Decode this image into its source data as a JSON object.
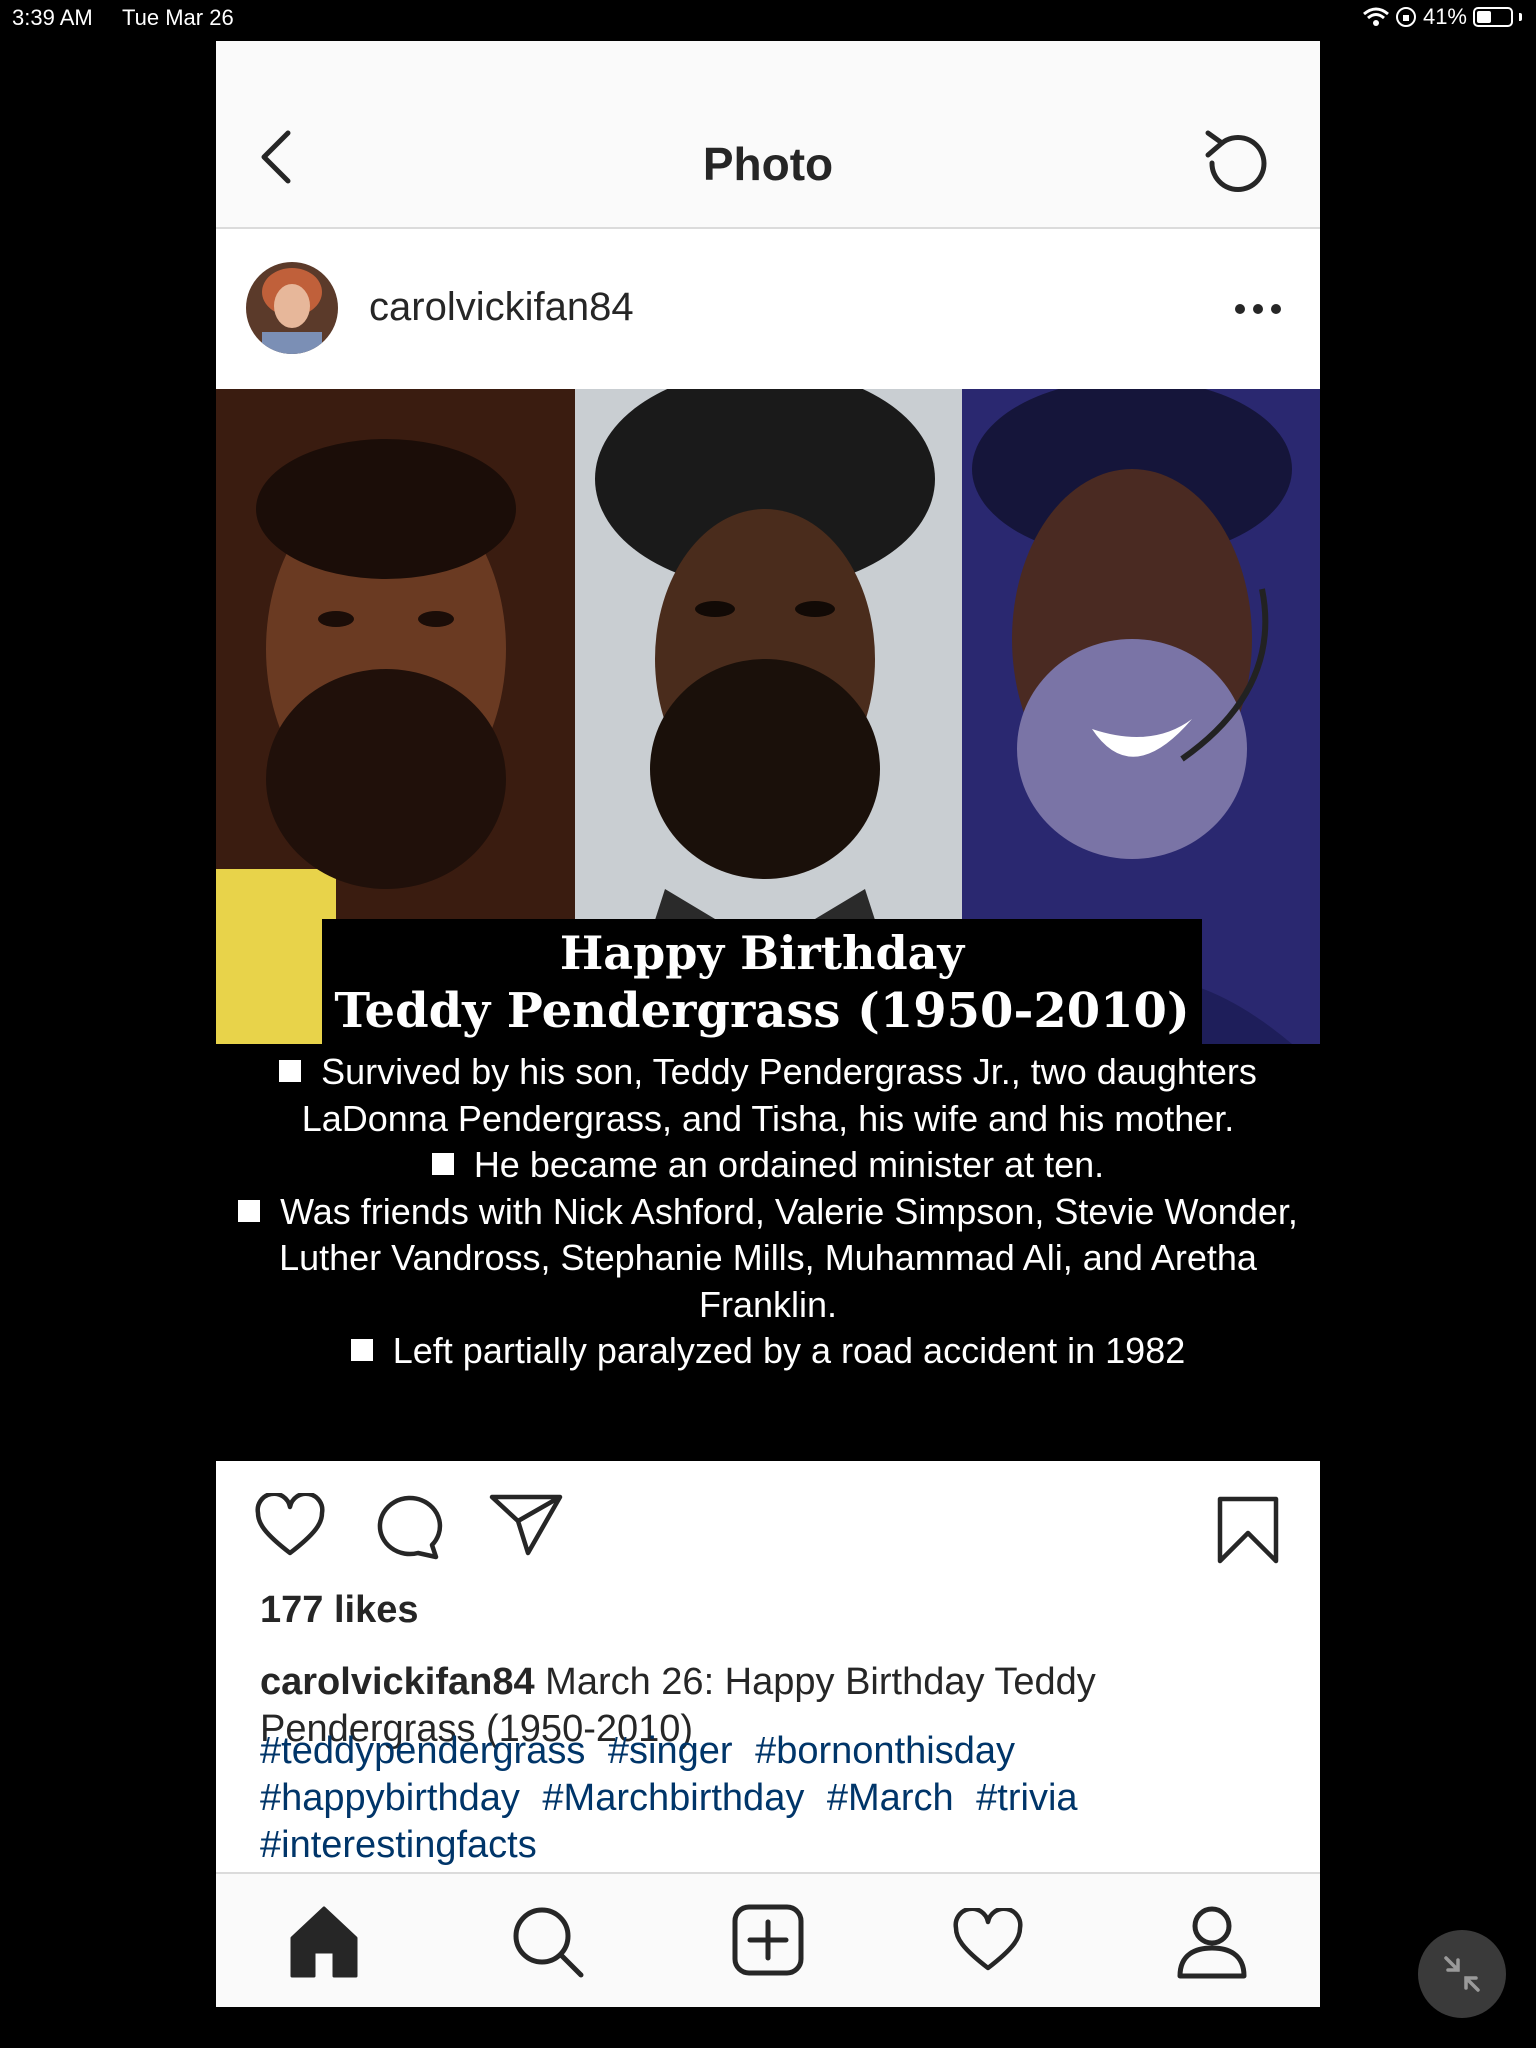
{
  "status_bar": {
    "time": "3:39 AM",
    "date": "Tue Mar 26",
    "battery": "41%"
  },
  "nav": {
    "title": "Photo",
    "back_icon": "chevron-left-icon",
    "refresh_icon": "refresh-icon"
  },
  "post": {
    "username": "carolvickifan84",
    "image": {
      "banner_line1": "Happy Birthday",
      "banner_line2": "Teddy Pendergrass (1950-2010)",
      "facts": [
        "Survived by his son, Teddy Pendergrass Jr., two daughters LaDonna Pendergrass, and Tisha, his wife and his mother.",
        "He became an ordained minister at ten.",
        "Was friends with Nick Ashford, Valerie Simpson, Stevie Wonder, Luther Vandross, Stephanie Mills, Muhammad Ali, and Aretha Franklin.",
        "Left partially paralyzed by a road accident in 1982"
      ]
    },
    "likes": "177 likes",
    "caption_user": "carolvickifan84",
    "caption_text": " March 26: Happy Birthday Teddy Pendergrass (1950-2010)",
    "hashtags": [
      "#teddypendergrass",
      "#singer",
      "#bornonthisday",
      "#happybirthday",
      "#Marchbirthday",
      "#March",
      "#trivia",
      "#interestingfacts"
    ]
  },
  "tab_bar": {
    "items": [
      "home-icon",
      "search-icon",
      "add-post-icon",
      "activity-heart-icon",
      "profile-icon"
    ]
  },
  "colors": {
    "hashtag": "#003569",
    "text": "#262626",
    "divider": "#dbdbdb"
  }
}
